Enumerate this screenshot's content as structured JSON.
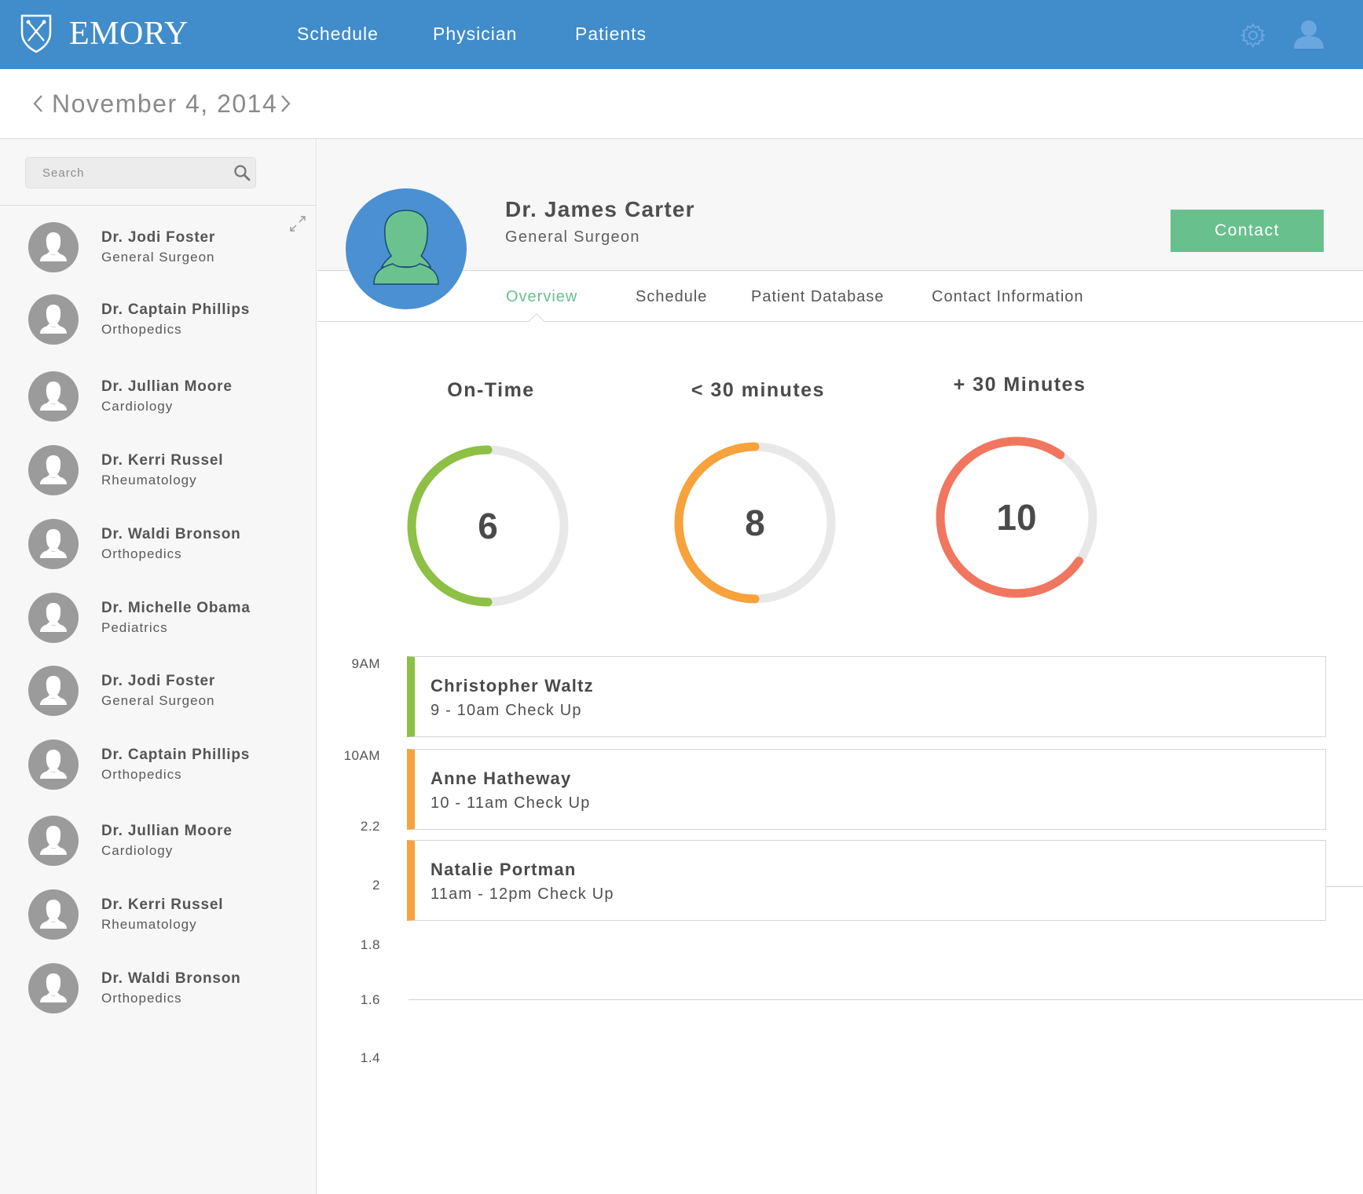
{
  "header": {
    "brand": "EMORY",
    "nav": [
      "Schedule",
      "Physician",
      "Patients"
    ],
    "icons": [
      "gear-icon",
      "user-icon"
    ],
    "color": "#418cca"
  },
  "date_bar": {
    "date": "November 4, 2014",
    "prev_icon": "chevron-left-icon",
    "next_icon": "chevron-right-icon"
  },
  "sidebar": {
    "search_placeholder": "Search",
    "doctors": [
      {
        "name": "Dr. Jodi Foster",
        "specialty": "General Surgeon"
      },
      {
        "name": "Dr. Captain Phillips",
        "specialty": "Orthopedics"
      },
      {
        "name": "Dr. Jullian Moore",
        "specialty": "Cardiology"
      },
      {
        "name": "Dr. Kerri Russel",
        "specialty": "Rheumatology"
      },
      {
        "name": "Dr. Waldi Bronson",
        "specialty": "Orthopedics"
      },
      {
        "name": "Dr. Michelle Obama",
        "specialty": "Pediatrics"
      },
      {
        "name": "Dr. Jodi Foster",
        "specialty": "General Surgeon"
      },
      {
        "name": "Dr. Captain Phillips",
        "specialty": "Orthopedics"
      },
      {
        "name": "Dr. Jullian Moore",
        "specialty": "Cardiology"
      },
      {
        "name": "Dr. Kerri Russel",
        "specialty": "Rheumatology"
      },
      {
        "name": "Dr. Waldi Bronson",
        "specialty": "Orthopedics"
      }
    ]
  },
  "profile": {
    "name": "Dr. James Carter",
    "role": "General Surgeon",
    "contact_label": "Contact"
  },
  "tabs": {
    "items": [
      "Overview",
      "Schedule",
      "Patient Database",
      "Contact Information"
    ],
    "active": "Overview",
    "active_color": "#68c08d"
  },
  "gauges": [
    {
      "title": "On-Time",
      "value": "6",
      "fill": 0.5,
      "color": "#8dc045"
    },
    {
      "title": "< 30 minutes",
      "value": "8",
      "fill": 0.5,
      "color": "#f7a23b"
    },
    {
      "title": "+ 30 Minutes",
      "value": "10",
      "fill": 0.75,
      "color": "#f1765f"
    }
  ],
  "schedule": {
    "y_labels": [
      "9AM",
      "10AM",
      "2.2",
      "2",
      "1.8",
      "1.6",
      "1.4"
    ],
    "appointments": [
      {
        "patient": "Christopher Waltz",
        "time": "9 - 10am Check Up",
        "color": "#8dc045"
      },
      {
        "patient": "Anne Hatheway",
        "time": "10 - 11am Check Up",
        "color": "#f7a23b"
      },
      {
        "patient": "Natalie Portman",
        "time": "11am - 12pm Check Up",
        "color": "#f7a23b"
      }
    ]
  }
}
